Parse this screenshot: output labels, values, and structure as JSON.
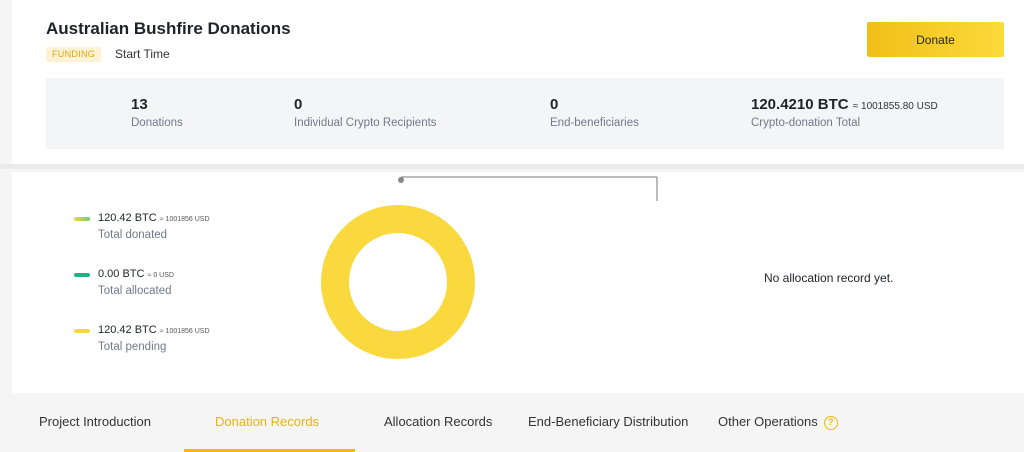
{
  "project": {
    "title": "Australian Bushfire Donations",
    "status_badge": "FUNDING",
    "start_time_label": "Start Time",
    "donate_label": "Donate"
  },
  "stats": [
    {
      "value": "13",
      "label": "Donations"
    },
    {
      "value": "0",
      "label": "Individual Crypto Recipients"
    },
    {
      "value": "0",
      "label": "End-beneficiaries"
    },
    {
      "value": "120.4210 BTC",
      "usd": "≈ 1001855.80 USD",
      "label": "Crypto-donation Total"
    }
  ],
  "legend": [
    {
      "value": "120.42 BTC",
      "usd": "≈ 1001856 USD",
      "label": "Total donated",
      "color_start": "#f5d63d",
      "color_end": "#6fcf6f"
    },
    {
      "value": "0.00 BTC",
      "usd": "≈ 0 USD",
      "label": "Total allocated",
      "color_start": "#18b580",
      "color_end": "#18b580"
    },
    {
      "value": "120.42 BTC",
      "usd": "≈ 1001856 USD",
      "label": "Total pending",
      "color_start": "#f8d737",
      "color_end": "#f8d737"
    }
  ],
  "donut": {
    "pending_fraction": 1.0,
    "color": "#f9d93d"
  },
  "allocation_empty_text": "No allocation record yet.",
  "tabs": [
    {
      "label": "Project Introduction",
      "active": false
    },
    {
      "label": "Donation Records",
      "active": true
    },
    {
      "label": "Allocation Records",
      "active": false
    },
    {
      "label": "End-Beneficiary Distribution",
      "active": false
    },
    {
      "label": "Other Operations",
      "active": false,
      "icon": "help-icon",
      "icon_text": "?"
    }
  ],
  "colors": {
    "accent": "#f0b90b",
    "text_primary": "#1e2329",
    "text_secondary": "#707a8a"
  }
}
